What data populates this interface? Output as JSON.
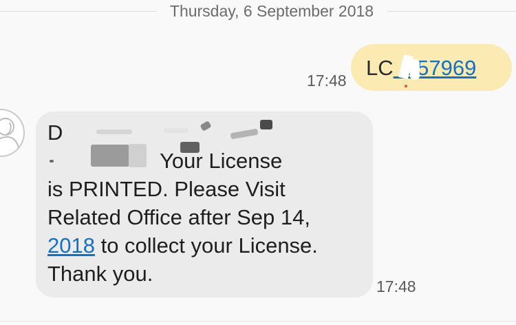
{
  "conversation": {
    "date_divider": "Thursday, 6 September 2018",
    "sent_message": {
      "text_prefix": "LC",
      "text_link_visible": "557969",
      "time": "17:48"
    },
    "received_message": {
      "sender_line_fragment": "D",
      "line2_visible": ", Your License",
      "line3": "is PRINTED. Please Visit",
      "line4": "Related Office after Sep 14,",
      "line5_link": "2018",
      "line5_rest": " to collect your License.",
      "line6": "Thank you.",
      "time": "17:48"
    }
  },
  "colors": {
    "background": "#f9f9f9",
    "sent_bubble": "#fbeab1",
    "received_bubble": "#ebebeb",
    "link": "#1570c1",
    "timestamp": "#5a5a5a"
  },
  "icons": {
    "avatar": "contact-avatar-icon"
  }
}
